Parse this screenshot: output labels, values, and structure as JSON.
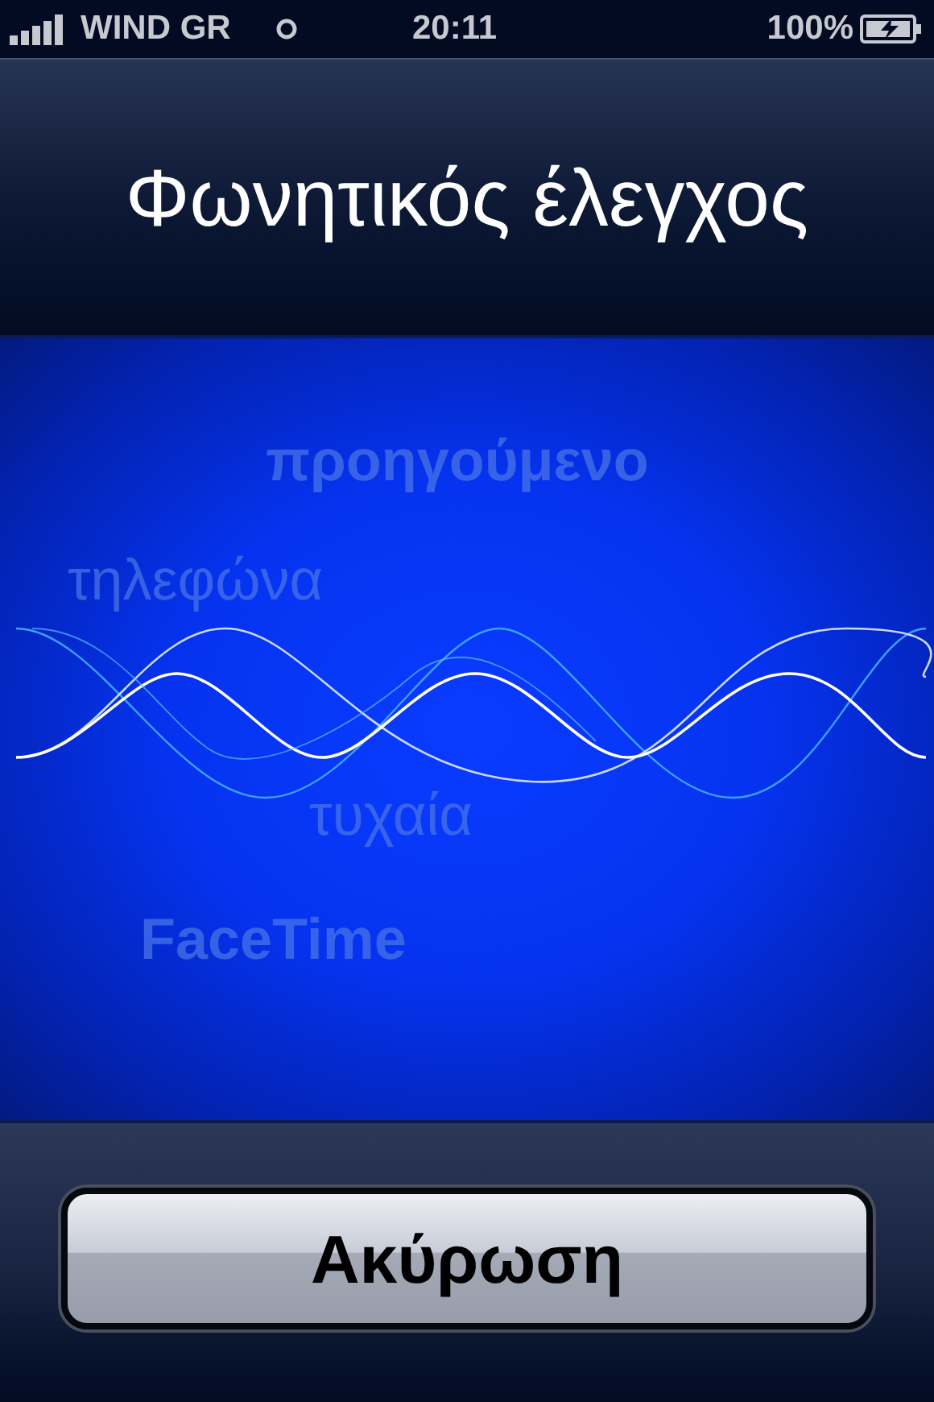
{
  "status_bar": {
    "carrier": "WIND GR",
    "time": "20:11",
    "battery": "100%"
  },
  "header": {
    "title": "Φωνητικός έλεγχος"
  },
  "suggestions": [
    {
      "text": "προηγούμενο",
      "kind": "bold"
    },
    {
      "text": "τηλεφώνα",
      "kind": "regular"
    },
    {
      "text": "τυχαία",
      "kind": "regular"
    },
    {
      "text": "FaceTime",
      "kind": "bold"
    }
  ],
  "cancel_button": {
    "label": "Ακύρωση"
  }
}
